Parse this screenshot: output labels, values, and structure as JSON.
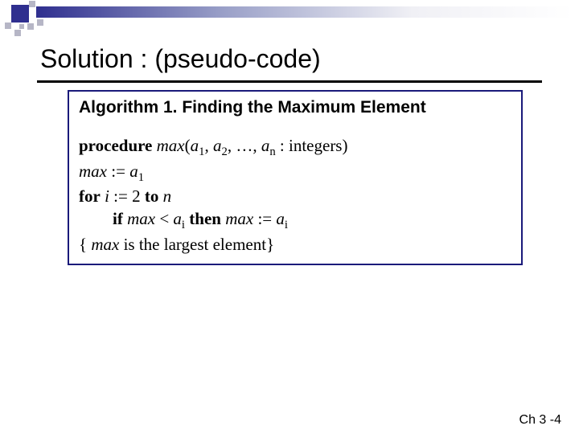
{
  "title": "Solution : (pseudo-code)",
  "box": {
    "heading": "Algorithm 1. Finding the Maximum Element",
    "line1": {
      "kw_procedure": "procedure",
      "fn": " max",
      "open": "(",
      "a": "a",
      "sub1": "1",
      "sep1": ", ",
      "a2": "a",
      "sub2": "2",
      "sep2": ", …, ",
      "an": "a",
      "subn": "n",
      "tail": " : integers)"
    },
    "line2": {
      "lhs": "max",
      "op": " := ",
      "rhs_a": "a",
      "rhs_sub": "1"
    },
    "line3": {
      "kw_for": "for",
      "i": " i",
      "rest": " := 2 ",
      "kw_to": "to",
      "n": " n"
    },
    "line4": {
      "kw_if": "if",
      "max1": " max",
      "lt": " < ",
      "ai1": "a",
      "subi1": "i",
      "sp1": " ",
      "kw_then": "then",
      "max2": " max",
      "assign": " := ",
      "ai2": "a",
      "subi2": "i"
    },
    "line5": {
      "open": "{",
      "max": " max",
      "tail": " is the largest element}"
    }
  },
  "footer": "Ch 3 -4"
}
